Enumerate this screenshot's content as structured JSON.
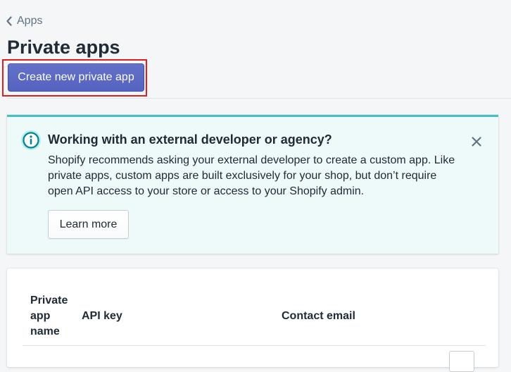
{
  "breadcrumb": {
    "label": "Apps",
    "icon": "chevron-left-icon"
  },
  "page": {
    "title": "Private apps",
    "create_button_label": "Create new private app"
  },
  "banner": {
    "icon": "info-icon",
    "title": "Working with an external developer or agency?",
    "body": "Shopify recommends asking your external developer to create a custom app. Like private apps, custom apps are built exclusively for your shop, but don’t require open API access to your store or access to your Shopify admin.",
    "learn_more_label": "Learn more",
    "dismiss_icon": "close-icon"
  },
  "table": {
    "columns": [
      "Private app name",
      "API key",
      "Contact email"
    ]
  },
  "colors": {
    "primary": "#5c6ac4",
    "banner_accent": "#47c1bf",
    "banner_background": "#eef9f9",
    "highlight": "#e01e1e"
  }
}
